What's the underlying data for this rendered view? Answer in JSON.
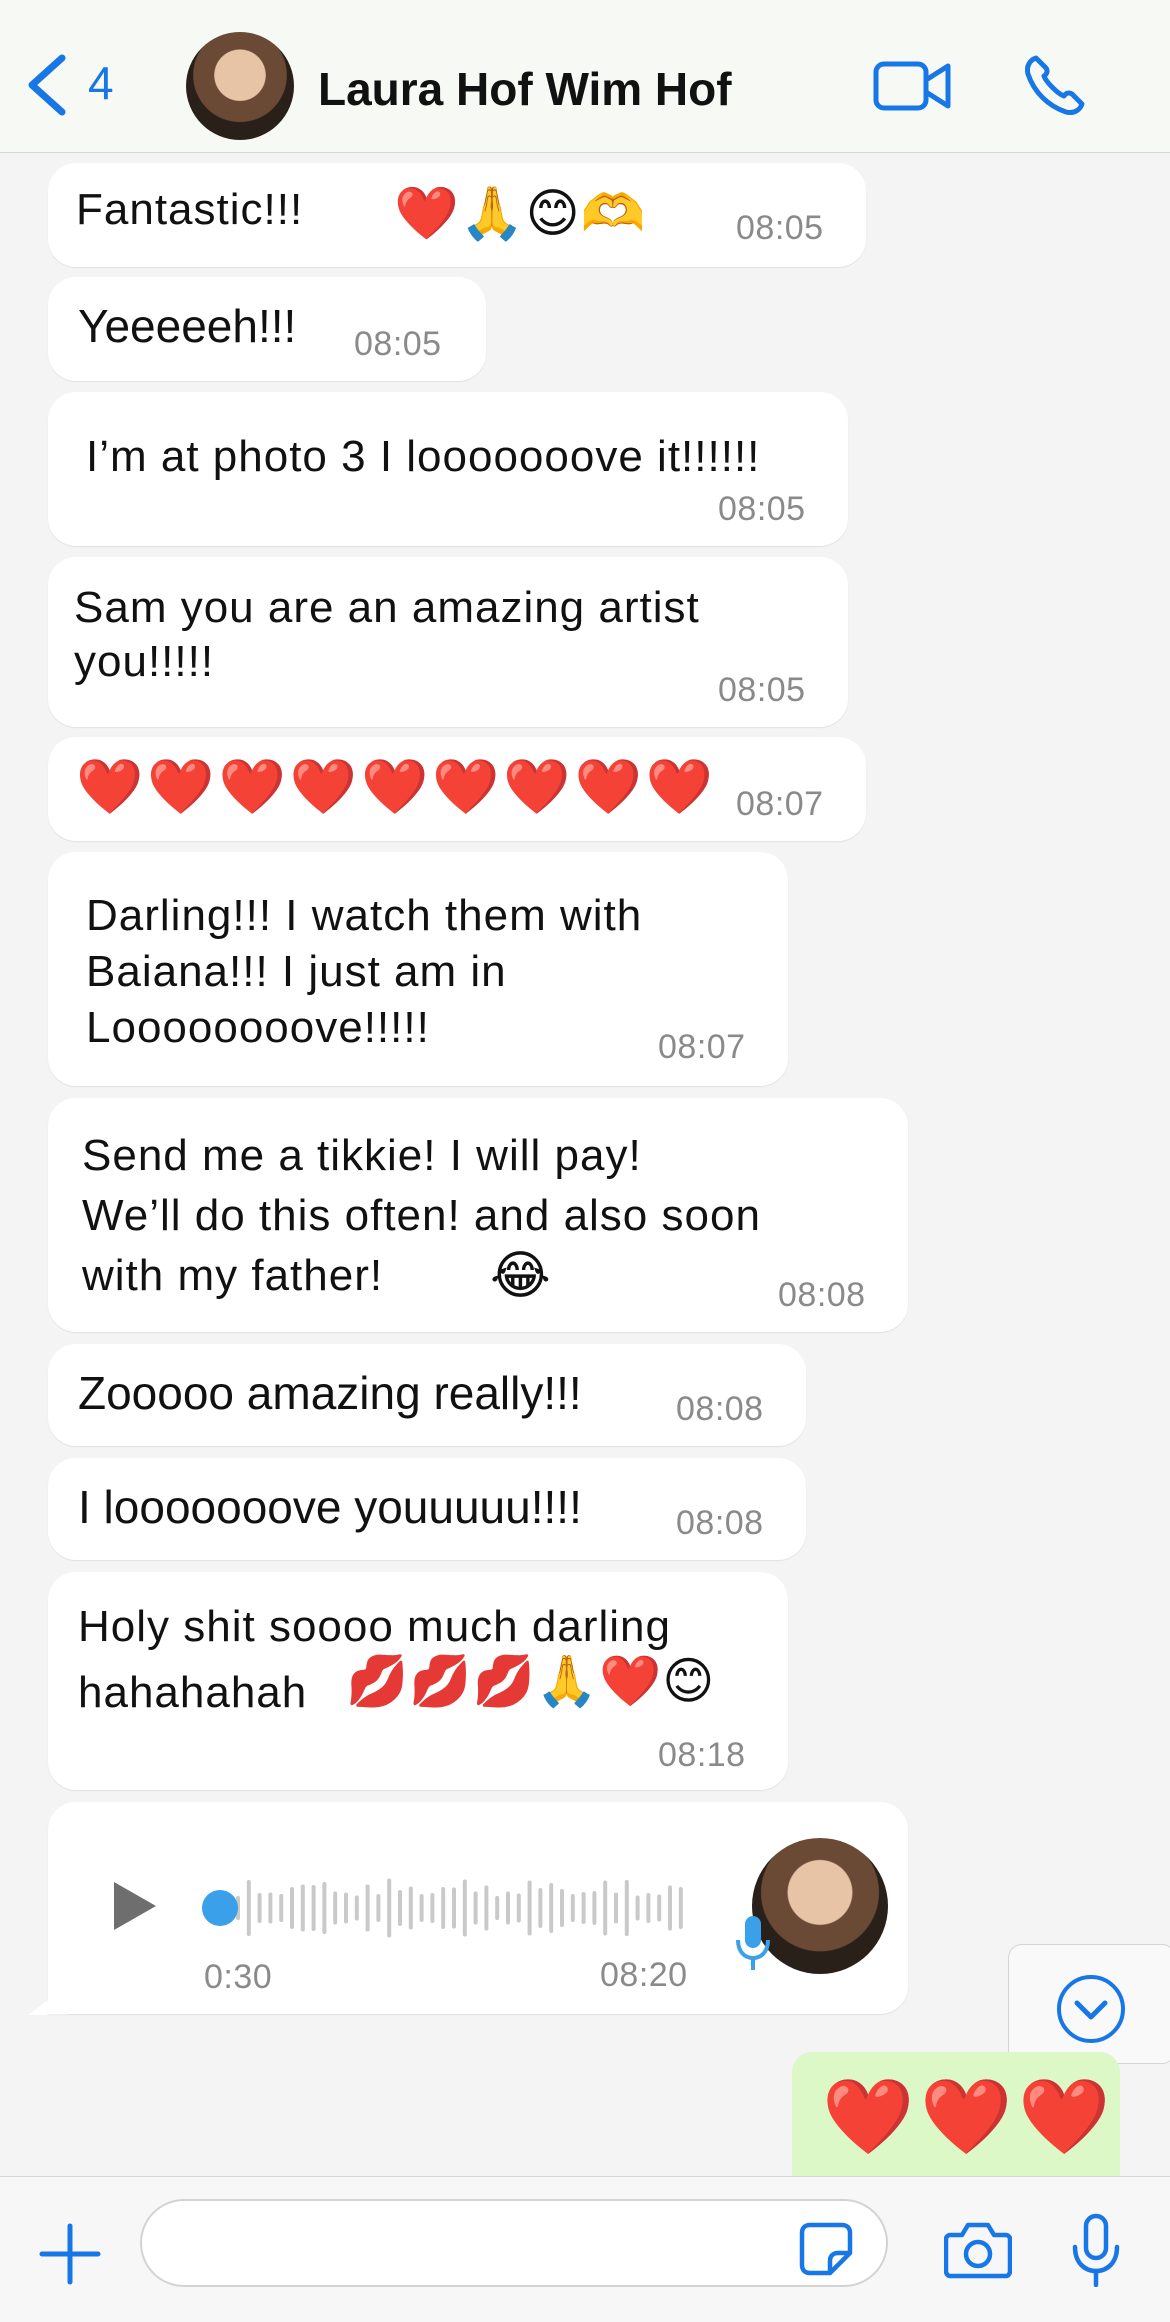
{
  "header": {
    "back_count": "4",
    "contact_name": "Laura Hof Wim Hof"
  },
  "messages": [
    {
      "text": "Fantastic!!!",
      "emoji": "❤️🙏😊🫶",
      "time": "08:05"
    },
    {
      "text": "Yeeeeeh!!!",
      "time": "08:05"
    },
    {
      "text": "I’m at photo 3 I looooooove it!!!!!!",
      "time": "08:05"
    },
    {
      "text": "Sam you are an amazing artist\nyou!!!!!",
      "time": "08:05"
    },
    {
      "text": "❤️❤️❤️❤️❤️❤️❤️❤️❤️",
      "time": "08:07"
    },
    {
      "text": "Darling!!! I watch them with\nBaiana!!! I just am in\nLoooooooove!!!!!",
      "time": "08:07"
    },
    {
      "text": "Send me a tikkie! I will pay!\nWe’ll do this often! and also soon\nwith my father!",
      "emoji": "😂",
      "time": "08:08"
    },
    {
      "text": "Zooooo amazing really!!!",
      "time": "08:08"
    },
    {
      "text": "I looooooove youuuuu!!!!",
      "time": "08:08"
    },
    {
      "text": "Holy shit soooo much darling\nhahahahah",
      "emoji": "💋💋💋🙏❤️😊",
      "time": "08:18"
    }
  ],
  "voice_note": {
    "duration": "0:30",
    "time": "08:20"
  },
  "outgoing": {
    "emoji": "❤️❤️❤️"
  },
  "composer": {
    "placeholder": ""
  },
  "colors": {
    "accent": "#1777e6",
    "outgoing_bubble": "#dcf8c6",
    "voice_dot": "#3aa0ea"
  }
}
